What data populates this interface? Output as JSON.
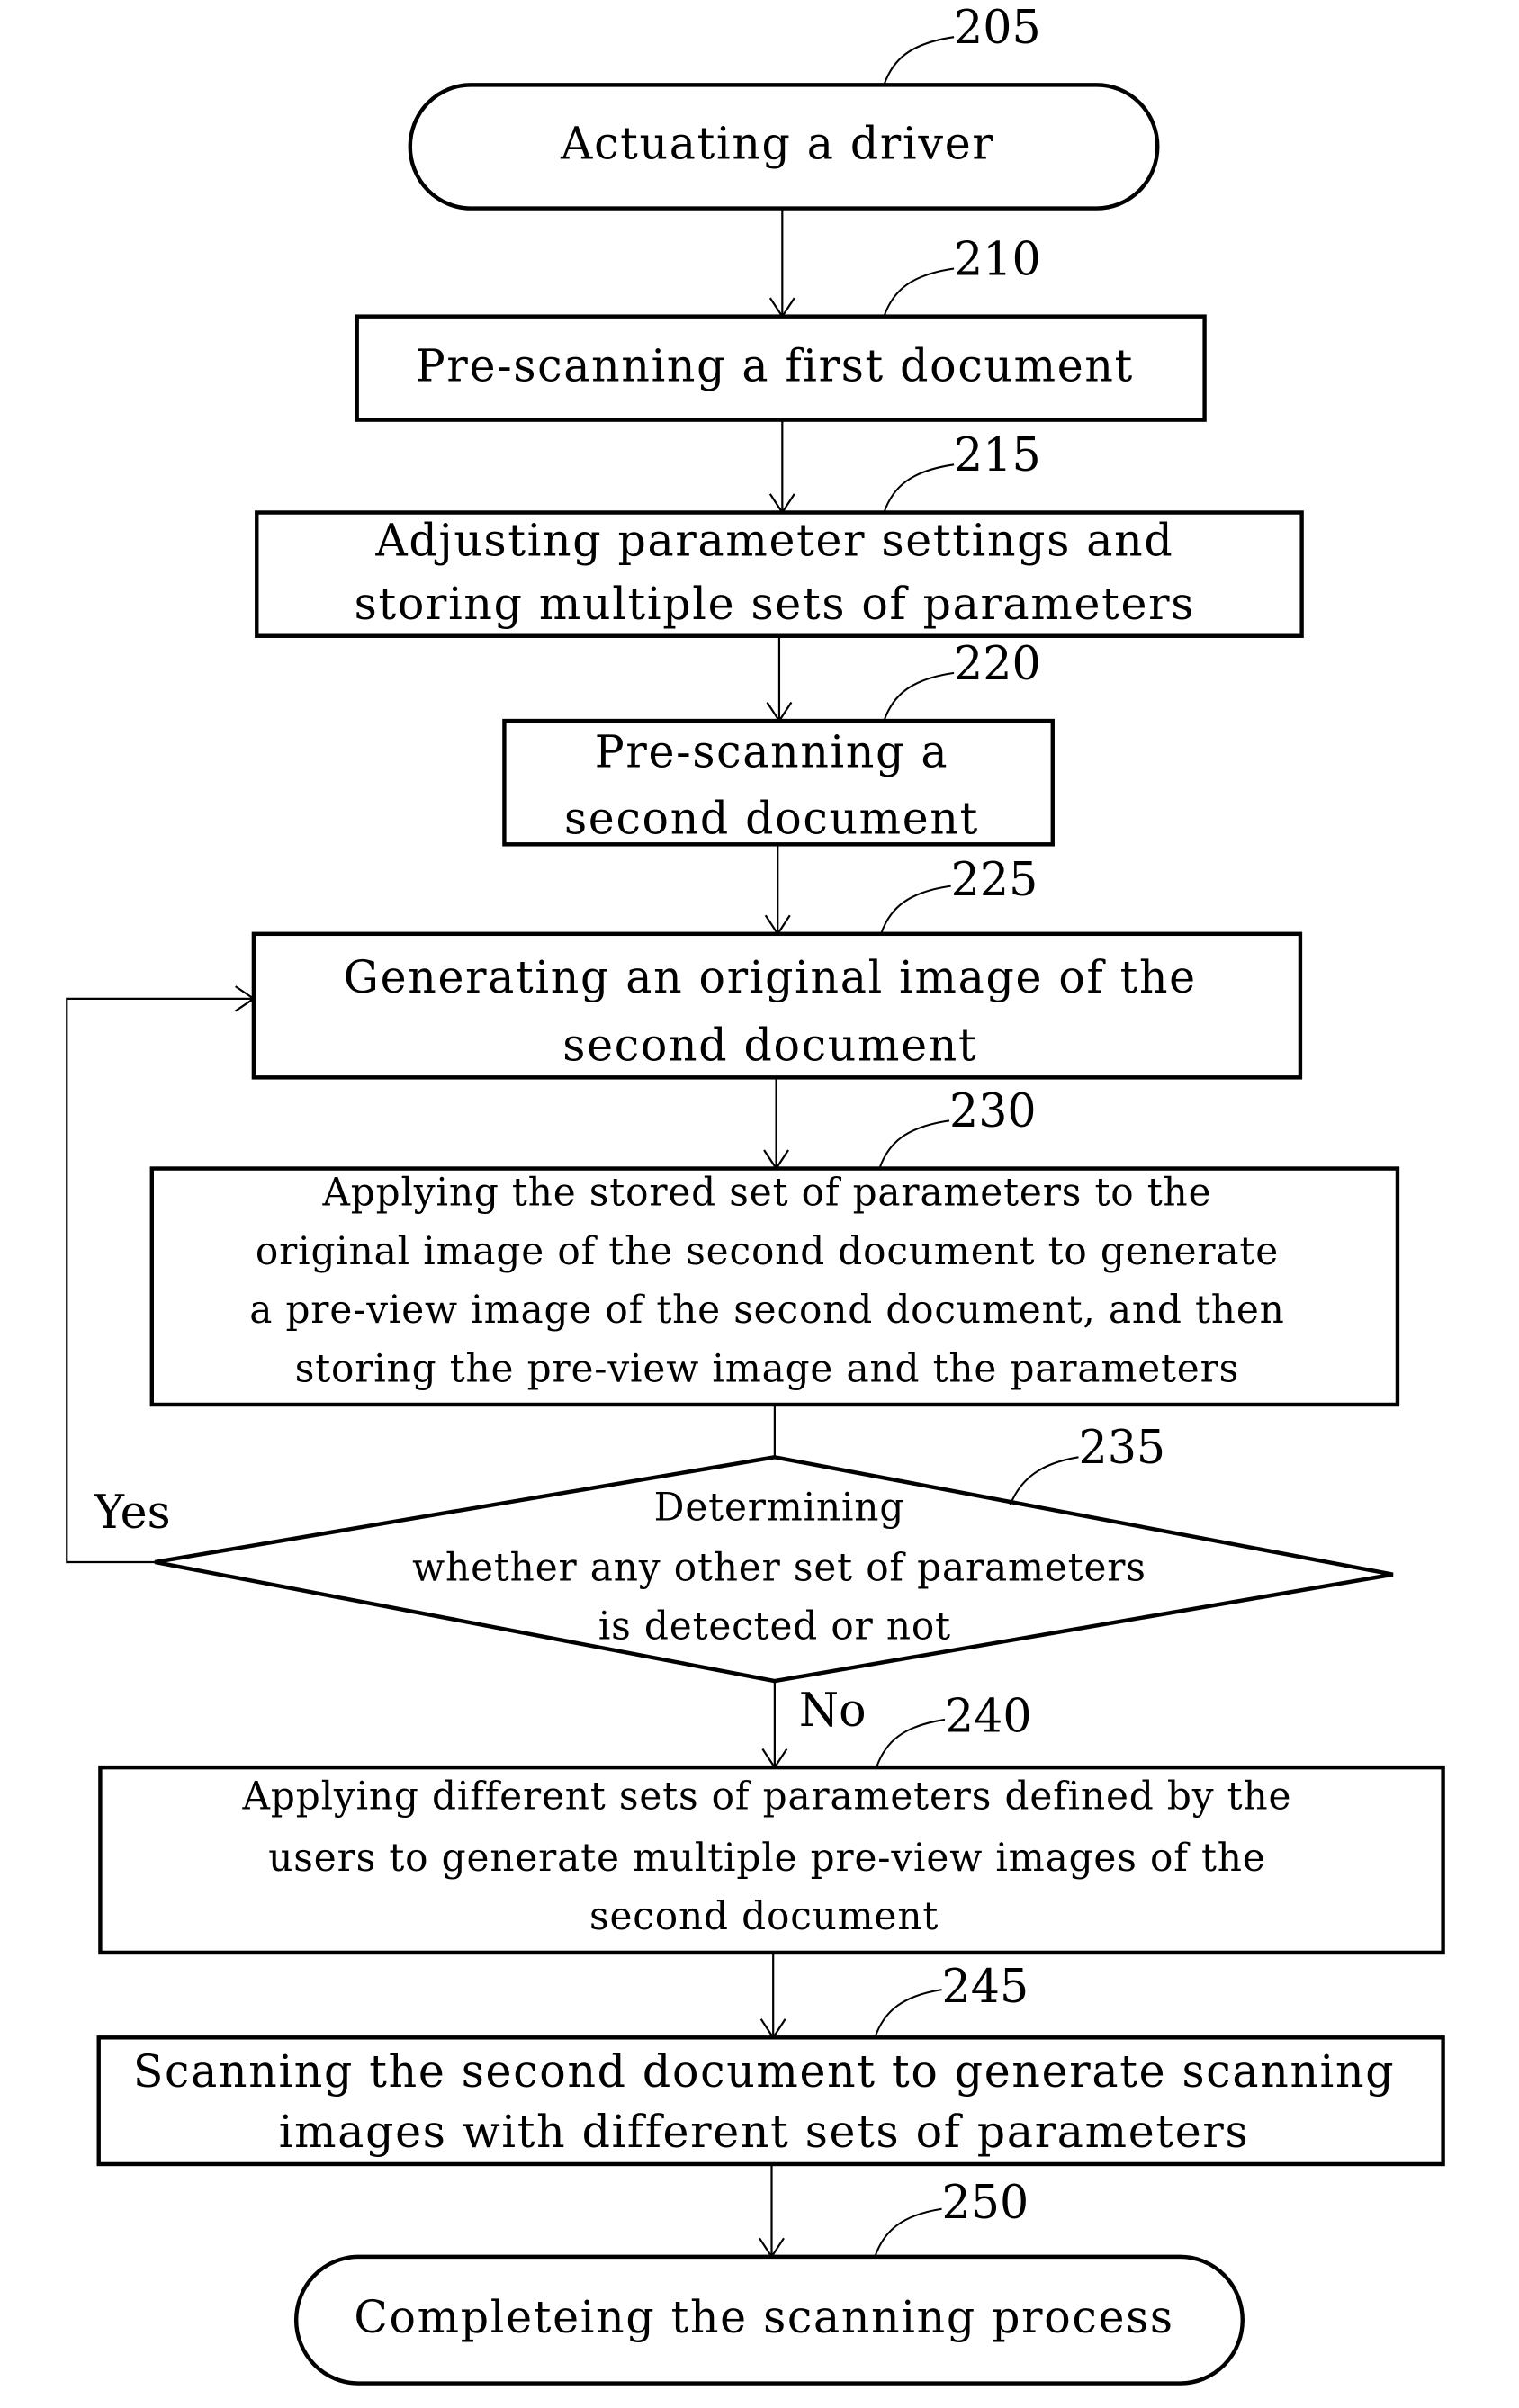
{
  "flowchart": {
    "steps": [
      {
        "ref": "205",
        "type": "terminal",
        "lines": [
          "Actuating a driver"
        ]
      },
      {
        "ref": "210",
        "type": "process",
        "lines": [
          "Pre-scanning a first document"
        ]
      },
      {
        "ref": "215",
        "type": "process",
        "lines": [
          "Adjusting parameter settings and",
          "storing multiple sets of parameters"
        ]
      },
      {
        "ref": "220",
        "type": "process",
        "lines": [
          "Pre-scanning a",
          "second document"
        ]
      },
      {
        "ref": "225",
        "type": "process",
        "lines": [
          "Generating an original image of the",
          "second document"
        ]
      },
      {
        "ref": "230",
        "type": "process",
        "lines": [
          "Applying the stored set of parameters to the",
          "original image of the second document to generate",
          "a pre-view image of the second document, and then",
          "storing the pre-view image and the parameters"
        ]
      },
      {
        "ref": "235",
        "type": "decision",
        "lines": [
          "Determining",
          "whether any other set of parameters",
          "is detected or not"
        ]
      },
      {
        "ref": "240",
        "type": "process",
        "lines": [
          "Applying different sets of parameters defined by the",
          "users to generate multiple pre-view images of the",
          "second document"
        ]
      },
      {
        "ref": "245",
        "type": "process",
        "lines": [
          "Scanning the second document to generate scanning",
          "images with different sets of parameters"
        ]
      },
      {
        "ref": "250",
        "type": "terminal",
        "lines": [
          "Completeing the scanning process"
        ]
      }
    ],
    "branches": {
      "yes_label": "Yes",
      "no_label": "No"
    }
  }
}
